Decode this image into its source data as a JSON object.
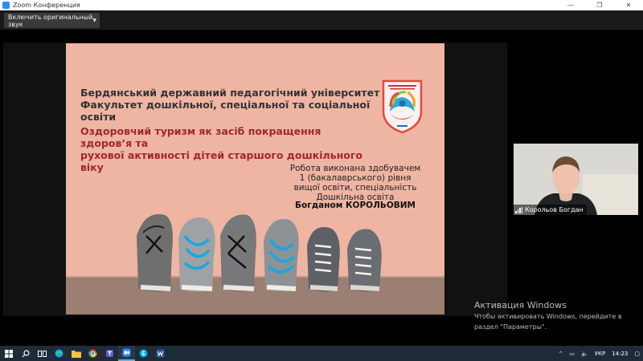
{
  "window": {
    "title": "Zoom Конференция",
    "minimize_glyph": "—",
    "restore_glyph": "❐",
    "close_glyph": "✕"
  },
  "toolbar": {
    "audio_button_label": "Включить оригинальный звук",
    "audio_caret": "▼"
  },
  "slide": {
    "university_line1": "Бердянський державний педагогічний університет",
    "university_line2": "Факультет дошкільної, спеціальної та соціальної освіти",
    "title_line1": "Оздоровчий туризм як засіб покращення здоров’я та",
    "title_line2": "рухової активності дітей старшого дошкільного віку",
    "work_line1": "Робота виконана здобувачем",
    "work_line2": "1 (бакалаврського) рівня",
    "work_line3": "вищої освіти, спеціальність",
    "work_line4": "Дошкільна освіта",
    "author": "Богданом КОРОЛЬОВИМ"
  },
  "participant": {
    "name": "Корольов Богдан"
  },
  "watermark": {
    "title": "Активация Windows",
    "line1": "Чтобы активировать Windows, перейдите в",
    "line2": "раздел \"Параметры\"."
  },
  "taskbar": {
    "icons": [
      "windows-start-icon",
      "search-icon",
      "task-view-icon",
      "edge-icon",
      "file-explorer-icon",
      "chrome-icon",
      "teams-icon",
      "zoom-icon",
      "skype-icon",
      "word-icon"
    ],
    "language": "УКР",
    "time": "14:23"
  },
  "colors": {
    "slide_background": "#efb5a3",
    "title_accent": "#a0282a",
    "zoom_blue": "#2d8cff",
    "taskbar": "#1f2b38"
  }
}
